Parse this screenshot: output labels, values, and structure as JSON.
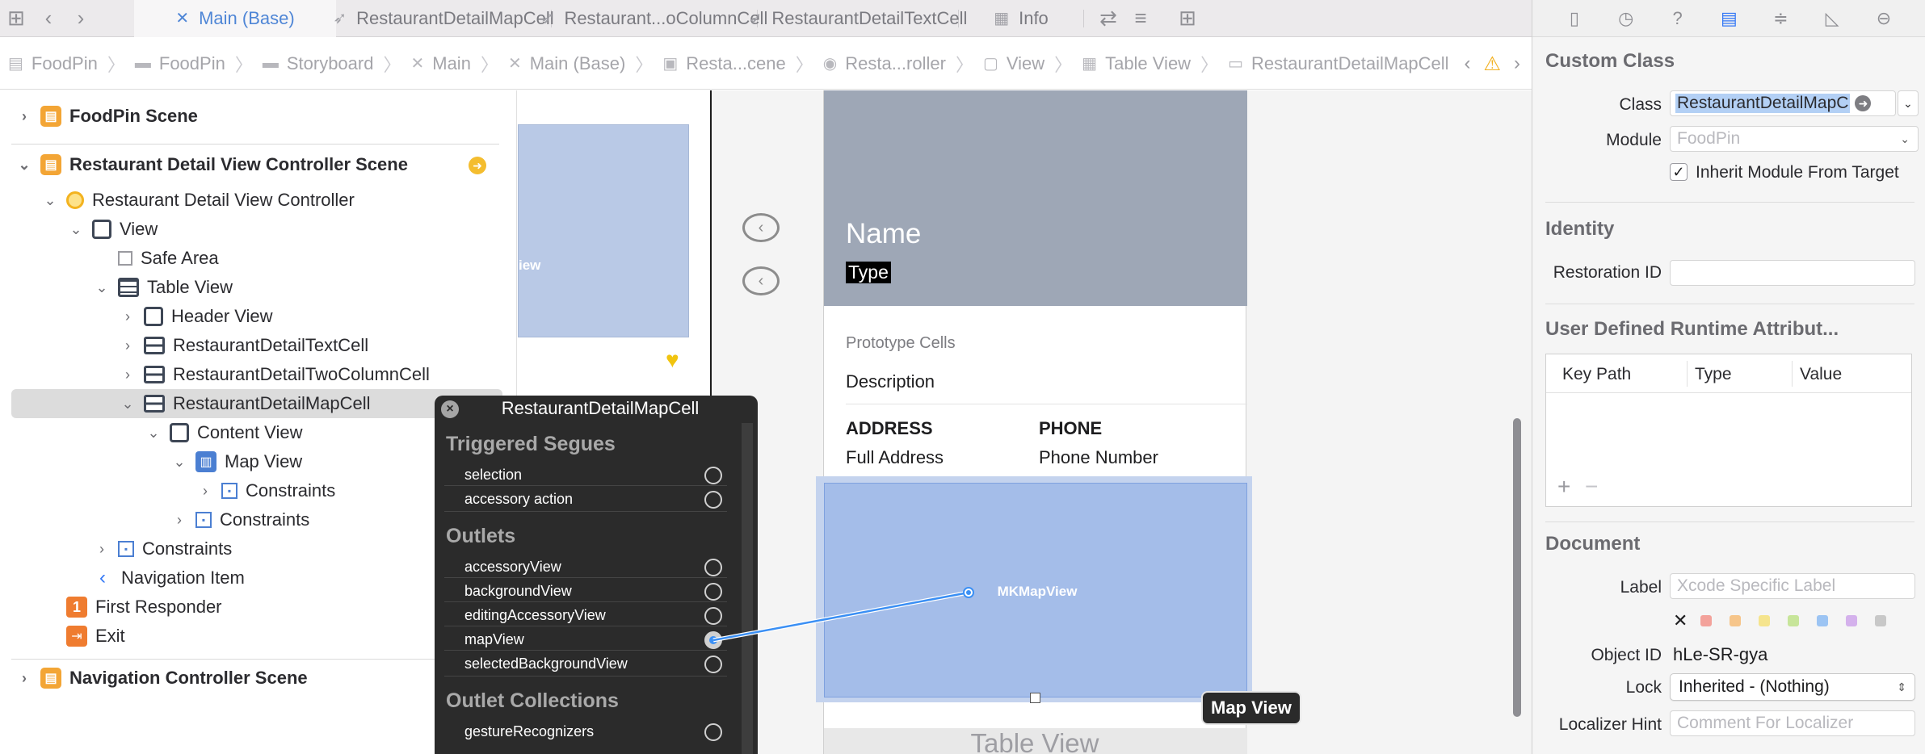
{
  "tabs": [
    {
      "label": "Main (Base)",
      "glyph": "✕",
      "active": true
    },
    {
      "label": "RestaurantDetailMapCell",
      "glyph": "🐦"
    },
    {
      "label": "Restaurant...oColumnCell",
      "glyph": "🐦"
    },
    {
      "label": "RestaurantDetailTextCell",
      "glyph": "🐦"
    },
    {
      "label": "Info",
      "glyph": "▦"
    }
  ],
  "breadcrumbs": [
    "FoodPin",
    "FoodPin",
    "Storyboard",
    "Main",
    "Main (Base)",
    "Resta...cene",
    "Resta...roller",
    "View",
    "Table View",
    "RestaurantDetailMapCell"
  ],
  "navigator": {
    "items": [
      {
        "label": "FoodPin Scene"
      },
      {
        "label": "Restaurant Detail View Controller Scene"
      },
      {
        "label": "Restaurant Detail View Controller"
      },
      {
        "label": "View"
      },
      {
        "label": "Safe Area"
      },
      {
        "label": "Table View"
      },
      {
        "label": "Header View"
      },
      {
        "label": "RestaurantDetailTextCell"
      },
      {
        "label": "RestaurantDetailTwoColumnCell"
      },
      {
        "label": "RestaurantDetailMapCell"
      },
      {
        "label": "Content View"
      },
      {
        "label": "Map View"
      },
      {
        "label": "Constraints"
      },
      {
        "label": "Constraints"
      },
      {
        "label": "Constraints"
      },
      {
        "label": "Navigation Item"
      },
      {
        "label": "First Responder"
      },
      {
        "label": "Exit"
      },
      {
        "label": "Navigation Controller Scene"
      }
    ],
    "first_responder_badge": "1"
  },
  "canvas": {
    "left_map_label": "iew",
    "header_name": "Name",
    "header_type": "Type",
    "prototype_cells": "Prototype Cells",
    "description": "Description",
    "address_title": "ADDRESS",
    "phone_title": "PHONE",
    "address_value": "Full Address",
    "phone_value": "Phone Number",
    "map_view_label": "MKMapView",
    "table_view_label": "Table View",
    "map_view_tag": "Map View"
  },
  "popup": {
    "title": "RestaurantDetailMapCell",
    "triggered_segues_title": "Triggered Segues",
    "triggered_segues": [
      "selection",
      "accessory action"
    ],
    "outlets_title": "Outlets",
    "outlets": [
      "accessoryView",
      "backgroundView",
      "editingAccessoryView",
      "mapView",
      "selectedBackgroundView"
    ],
    "outlet_collections_title": "Outlet Collections",
    "outlet_collections": [
      "gestureRecognizers"
    ],
    "connected_outlet": "mapView"
  },
  "inspector": {
    "custom_class": {
      "title": "Custom Class",
      "class_label": "Class",
      "class_value": "RestaurantDetailMapC",
      "module_label": "Module",
      "module_placeholder": "FoodPin",
      "inherit_label": "Inherit Module From Target",
      "inherit_checked": true
    },
    "identity": {
      "title": "Identity",
      "restoration_label": "Restoration ID",
      "restoration_value": ""
    },
    "udra": {
      "title": "User Defined Runtime Attribut...",
      "columns": [
        "Key Path",
        "Type",
        "Value"
      ]
    },
    "document": {
      "title": "Document",
      "label_label": "Label",
      "label_placeholder": "Xcode Specific Label",
      "object_id_label": "Object ID",
      "object_id_value": "hLe-SR-gya",
      "lock_label": "Lock",
      "lock_value": "Inherited - (Nothing)",
      "localizer_label": "Localizer Hint",
      "localizer_placeholder": "Comment For Localizer"
    },
    "label_colors": [
      "#f3a29b",
      "#f6c58a",
      "#f5e48d",
      "#c7e59a",
      "#9cc4f3",
      "#d4b1ec",
      "#c8c8c8"
    ]
  },
  "colors": {
    "accent": "#3478f6",
    "header_view": "#9ea7b6",
    "map_view": "#a4bde9"
  }
}
